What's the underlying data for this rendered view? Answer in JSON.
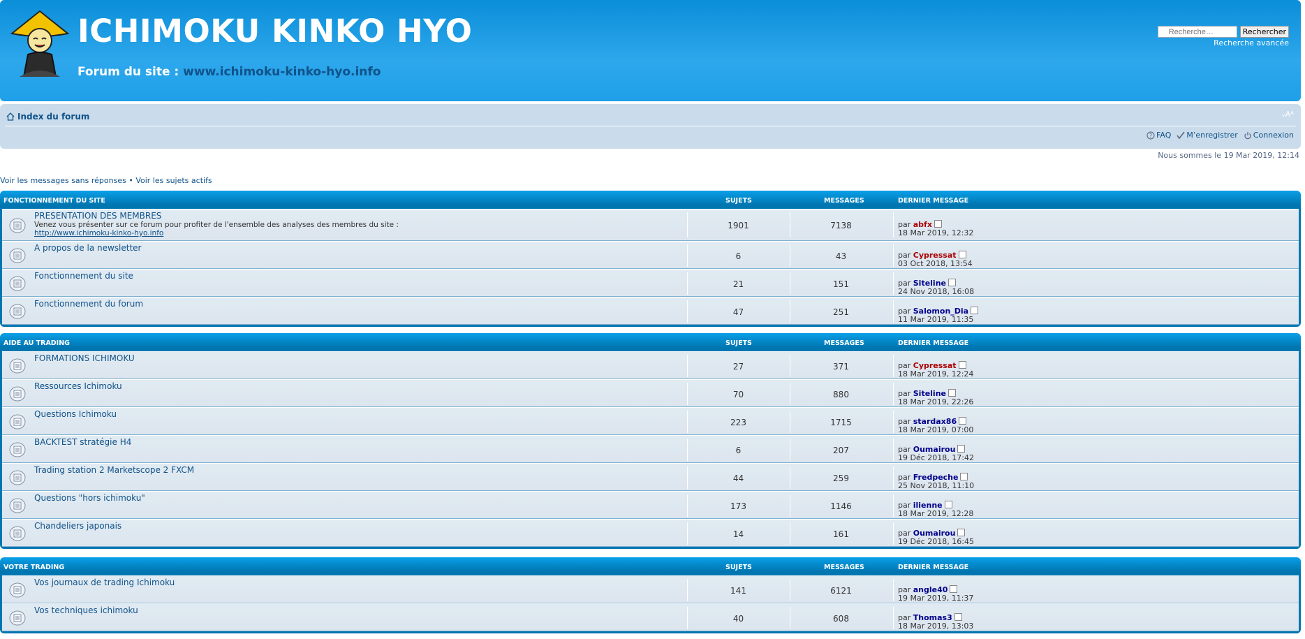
{
  "header": {
    "site_title": "ICHIMOKU KINKO HYO",
    "site_desc_prefix": "Forum du site : ",
    "site_desc_link": "www.ichimoku-kinko-hyo.info",
    "search_placeholder": "Recherche…",
    "search_button": "Rechercher",
    "advanced_search": "Recherche avancée"
  },
  "nav": {
    "index_label": "Index du forum",
    "font_control": "ᵥAᴬ",
    "faq": "FAQ",
    "register": "M’enregistrer",
    "login": "Connexion"
  },
  "date_line": "Nous sommes le 19 Mar 2019, 12:14",
  "quick_links": {
    "unanswered": "Voir les messages sans réponses",
    "separator": " • ",
    "active": "Voir les sujets actifs"
  },
  "columns": {
    "topics": "SUJETS",
    "posts": "MESSAGES",
    "last": "DERNIER MESSAGE"
  },
  "by_label": "par ",
  "categories": [
    {
      "name": "FONCTIONNEMENT DU SITE",
      "forums": [
        {
          "title": "PRESENTATION DES MEMBRES",
          "desc": "Venez vous présenter sur ce forum pour profiter de l'ensemble des analyses des membres du site :",
          "desc_link": "http://www.ichimoku-kinko-hyo.info",
          "topics": "1901",
          "posts": "7138",
          "last_user": "abfx",
          "last_date": "18 Mar 2019, 12:32",
          "red": true
        },
        {
          "title": "A propos de la newsletter",
          "topics": "6",
          "posts": "43",
          "last_user": "Cypressat",
          "last_date": "03 Oct 2018, 13:54",
          "red": true
        },
        {
          "title": "Fonctionnement du site",
          "topics": "21",
          "posts": "151",
          "last_user": "Siteline",
          "last_date": "24 Nov 2018, 16:08",
          "red": false
        },
        {
          "title": "Fonctionnement du forum",
          "topics": "47",
          "posts": "251",
          "last_user": "Salomon_Dia",
          "last_date": "11 Mar 2019, 11:35",
          "red": false
        }
      ]
    },
    {
      "name": "AIDE AU TRADING",
      "forums": [
        {
          "title": "FORMATIONS ICHIMOKU",
          "topics": "27",
          "posts": "371",
          "last_user": "Cypressat",
          "last_date": "18 Mar 2019, 12:24",
          "red": true
        },
        {
          "title": "Ressources Ichimoku",
          "topics": "70",
          "posts": "880",
          "last_user": "Siteline",
          "last_date": "18 Mar 2019, 22:26",
          "red": false
        },
        {
          "title": "Questions Ichimoku",
          "topics": "223",
          "posts": "1715",
          "last_user": "stardax86",
          "last_date": "18 Mar 2019, 07:00",
          "red": false
        },
        {
          "title": "BACKTEST stratégie H4",
          "topics": "6",
          "posts": "207",
          "last_user": "Oumairou",
          "last_date": "19 Déc 2018, 17:42",
          "red": false
        },
        {
          "title": "Trading station 2 Marketscope 2 FXCM",
          "topics": "44",
          "posts": "259",
          "last_user": "Fredpeche",
          "last_date": "25 Nov 2018, 11:10",
          "red": false
        },
        {
          "title": "Questions \"hors ichimoku\"",
          "topics": "173",
          "posts": "1146",
          "last_user": "ilienne",
          "last_date": "18 Mar 2019, 12:28",
          "red": false
        },
        {
          "title": "Chandeliers japonais",
          "topics": "14",
          "posts": "161",
          "last_user": "Oumairou",
          "last_date": "19 Déc 2018, 16:45",
          "red": false
        }
      ]
    },
    {
      "name": "VOTRE TRADING",
      "forums": [
        {
          "title": "Vos journaux de trading Ichimoku",
          "topics": "141",
          "posts": "6121",
          "last_user": "angle40",
          "last_date": "19 Mar 2019, 11:37",
          "red": false
        },
        {
          "title": "Vos techniques ichimoku",
          "topics": "40",
          "posts": "608",
          "last_user": "Thomas3",
          "last_date": "18 Mar 2019, 13:03",
          "red": false
        }
      ]
    }
  ]
}
